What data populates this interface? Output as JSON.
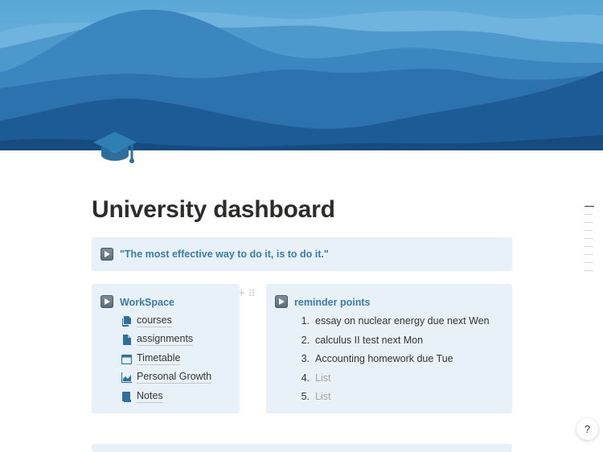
{
  "page": {
    "title": "University dashboard",
    "quote": "\"The most effective way to do it, is to do it.\""
  },
  "workspace": {
    "heading": "WorkSpace",
    "items": [
      {
        "label": "courses",
        "icon": "document-icon"
      },
      {
        "label": "assignments",
        "icon": "page-icon"
      },
      {
        "label": "Timetable",
        "icon": "calendar-icon"
      },
      {
        "label": "Personal Growth",
        "icon": "chart-icon"
      },
      {
        "label": "Notes",
        "icon": "notebook-icon"
      }
    ]
  },
  "reminders": {
    "heading": "reminder points",
    "items": [
      {
        "num": "1.",
        "text": "essay on nuclear energy due next Wen"
      },
      {
        "num": "2.",
        "text": "calculus II test next Mon"
      },
      {
        "num": "3.",
        "text": "Accounting homework due Tue"
      },
      {
        "num": "4.",
        "text": "List"
      },
      {
        "num": "5.",
        "text": "List"
      }
    ]
  },
  "help": {
    "label": "?"
  },
  "colors": {
    "accent": "#3a7ca5",
    "callout_bg": "#e7f1f7",
    "text": "#37352f",
    "placeholder": "#a6a5a1"
  }
}
